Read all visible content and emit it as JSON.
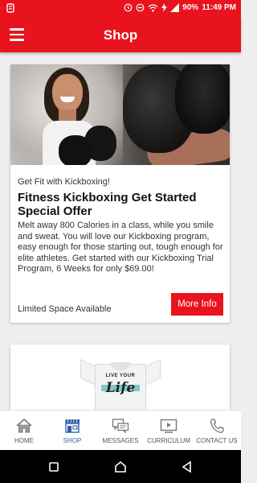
{
  "status_bar": {
    "battery": "90%",
    "time": "11:49 PM"
  },
  "header": {
    "title": "Shop",
    "menu_icon": "hamburger-menu-icon"
  },
  "cards": [
    {
      "image": "kickboxing-photo",
      "subtitle": "Get Fit with Kickboxing!",
      "title": "Fitness Kickboxing Get Started Special Offer",
      "description": "Melt away 800 Calories in a class, while you smile and sweat.  You will love our Kickboxing program, easy enough for those starting out, tough enough for elite athletes.  Get started with our Kickboxing Trial Program, 6 Weeks for only $69.00!",
      "footer_text": "Limited Space Available",
      "button_label": "More Info"
    },
    {
      "image": "t-shirt-photo",
      "shirt_text_top": "LIVE YOUR",
      "shirt_text_main": "Life"
    }
  ],
  "bottom_nav": [
    {
      "label": "HOME",
      "icon": "home-icon",
      "active": false
    },
    {
      "label": "SHOP",
      "icon": "shop-icon",
      "active": true
    },
    {
      "label": "MESSAGES",
      "icon": "messages-icon",
      "active": false
    },
    {
      "label": "CURRICULUM",
      "icon": "video-icon",
      "active": false
    },
    {
      "label": "CONTACT US",
      "icon": "phone-icon",
      "active": false
    }
  ],
  "colors": {
    "primary": "#e8131c",
    "nav_active": "#2f5fa8"
  }
}
